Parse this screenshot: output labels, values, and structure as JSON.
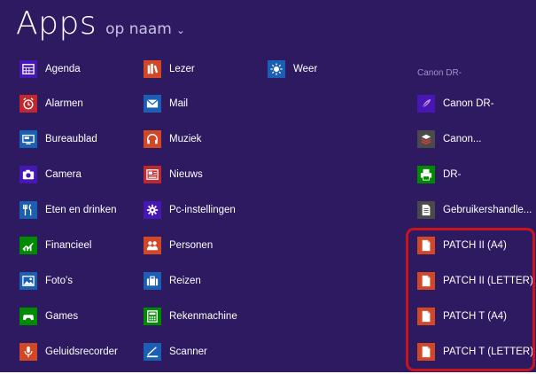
{
  "header": {
    "title": "Apps",
    "sort_label": "op naam",
    "sort_chevron": "⌄"
  },
  "group_header": "Canon DR-",
  "colors": {
    "background": "#2d1a61",
    "purple_tile": "#4617b4",
    "blue_tile": "#1a5fb4",
    "orange_tile": "#d24726",
    "red_tile": "#c1272d",
    "green_tile": "#008a00",
    "gray_tile": "#4a4a4a",
    "highlight": "#c8141a"
  },
  "columns": [
    [
      {
        "label": "Agenda",
        "icon": "calendar-icon",
        "color": "#4617b4"
      },
      {
        "label": "Alarmen",
        "icon": "alarm-clock-icon",
        "color": "#c1272d"
      },
      {
        "label": "Bureaublad",
        "icon": "desktop-icon",
        "color": "#1a5fb4"
      },
      {
        "label": "Camera",
        "icon": "camera-icon",
        "color": "#4617b4"
      },
      {
        "label": "Eten en drinken",
        "icon": "fork-knife-icon",
        "color": "#1a5fb4"
      },
      {
        "label": "Financieel",
        "icon": "finance-chart-icon",
        "color": "#008a00"
      },
      {
        "label": "Foto's",
        "icon": "photo-icon",
        "color": "#1a5fb4"
      },
      {
        "label": "Games",
        "icon": "gamepad-icon",
        "color": "#008a00"
      },
      {
        "label": "Geluidsrecorder",
        "icon": "microphone-icon",
        "color": "#d24726"
      }
    ],
    [
      {
        "label": "Lezer",
        "icon": "reader-icon",
        "color": "#d24726"
      },
      {
        "label": "Mail",
        "icon": "mail-icon",
        "color": "#1a5fb4"
      },
      {
        "label": "Muziek",
        "icon": "headphones-icon",
        "color": "#d24726"
      },
      {
        "label": "Nieuws",
        "icon": "newspaper-icon",
        "color": "#c1272d"
      },
      {
        "label": "Pc-instellingen",
        "icon": "gear-icon",
        "color": "#4617b4"
      },
      {
        "label": "Personen",
        "icon": "people-icon",
        "color": "#d24726"
      },
      {
        "label": "Reizen",
        "icon": "suitcase-icon",
        "color": "#1a5fb4"
      },
      {
        "label": "Rekenmachine",
        "icon": "calculator-icon",
        "color": "#008a00"
      },
      {
        "label": "Scanner",
        "icon": "scanner-icon",
        "color": "#1a5fb4"
      }
    ],
    [
      {
        "label": "Weer",
        "icon": "sun-icon",
        "color": "#1a5fb4"
      }
    ],
    [
      {
        "label": "Canon DR-",
        "icon": "canon-feather-icon",
        "color": "#4617b4"
      },
      {
        "label": "Canon...",
        "icon": "canon-stack-icon",
        "color": "#4a4a4a"
      },
      {
        "label": "DR-",
        "icon": "printer-icon",
        "color": "#008a00"
      },
      {
        "label": "Gebruikershandle...",
        "icon": "manual-icon",
        "color": "#4a4a4a"
      },
      {
        "label": "PATCH II (A4)",
        "icon": "document-icon",
        "color": "#d24726"
      },
      {
        "label": "PATCH II (LETTER)",
        "icon": "document-icon",
        "color": "#d24726"
      },
      {
        "label": "PATCH T (A4)",
        "icon": "document-icon",
        "color": "#d24726"
      },
      {
        "label": "PATCH T (LETTER)",
        "icon": "document-icon",
        "color": "#d24726"
      }
    ]
  ]
}
